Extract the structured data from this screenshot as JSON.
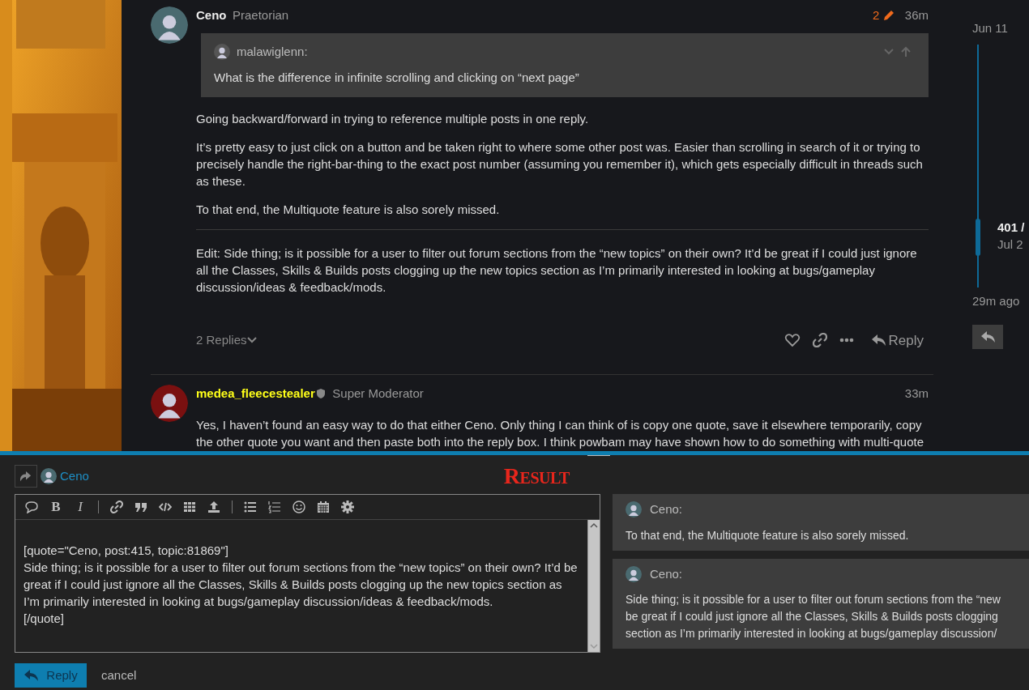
{
  "posts": [
    {
      "author": "Ceno",
      "moderator": false,
      "user_title": "Praetorian",
      "edits": "2",
      "time": "36m",
      "quote": {
        "author": "malawiglenn:",
        "text": "What is the difference in infinite scrolling and clicking on “next page”"
      },
      "paragraphs": [
        "Going backward/forward in trying to reference multiple posts in one reply.",
        "It’s pretty easy to just click on a button and be taken right to where some other post was. Easier than scrolling in search of it or trying to precisely handle the right-bar-thing to the exact post number (assuming you remember it), which gets especially difficult in threads such as these.",
        "To that end, the Multiquote feature is also sorely missed."
      ],
      "edit_note": "Edit: Side thing; is it possible for a user to filter out forum sections from the “new topics” on their own? It’d be great if I could just ignore all the Classes, Skills & Builds posts clogging up the new topics section as I’m primarily interested in looking at bugs/gameplay discussion/ideas & feedback/mods.",
      "replies": "2 Replies",
      "reply_label": "Reply"
    },
    {
      "author": "medea_fleecestealer",
      "moderator": true,
      "user_title": "Super Moderator",
      "time": "33m",
      "paragraphs": [
        "Yes, I haven’t found an easy way to do that either Ceno. Only thing I can think of is copy one quote, save it elsewhere temporarily, copy the other quote you want and then paste both into the reply box. I think powbam may have shown how to do something with multi-quote"
      ]
    }
  ],
  "timeline": {
    "start": "Jun 11",
    "position": "401 /",
    "position_date": "Jul 2",
    "level": 0.85,
    "ago": "29m ago"
  },
  "composer": {
    "reply_to": "Ceno",
    "overlay_label": "RESULT",
    "format_letters": [
      "B",
      "I"
    ],
    "editor_lines": [
      "[quote=\"Ceno, post:415, topic:81869\"]",
      "Side thing; is it possible for a user to filter out forum sections from the “new topics” on their own? It’d be great if I could just ignore all the Classes, Skills & Builds posts clogging up the new topics section as I’m primarily interested in looking at bugs/gameplay discussion/ideas & feedback/mods.",
      "[/quote]"
    ],
    "preview_quotes": [
      {
        "author": "Ceno:",
        "lines": [
          "To that end, the Multiquote feature is also sorely missed."
        ]
      },
      {
        "author": "Ceno:",
        "lines": [
          "Side thing; is it possible for a user to filter out forum sections from the “new",
          "be great if I could just ignore all the Classes, Skills & Builds posts clogging",
          "section as I’m primarily interested in looking at bugs/gameplay discussion/"
        ]
      }
    ],
    "submit": "Reply",
    "cancel": "cancel"
  }
}
